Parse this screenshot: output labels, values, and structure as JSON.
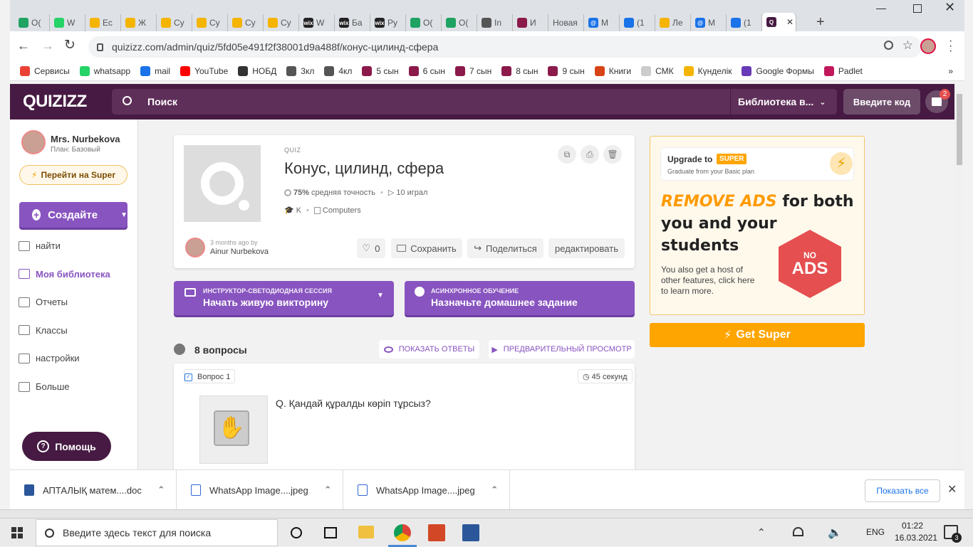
{
  "browser": {
    "tabs": [
      {
        "label": "О(",
        "color": "#1ea362",
        "glyph": ""
      },
      {
        "label": "W",
        "color": "#25d366",
        "glyph": ""
      },
      {
        "label": "Ес",
        "color": "#f4b400",
        "glyph": ""
      },
      {
        "label": "Ж",
        "color": "#f4b400",
        "glyph": ""
      },
      {
        "label": "Су",
        "color": "#f4b400",
        "glyph": ""
      },
      {
        "label": "Су",
        "color": "#f4b400",
        "glyph": ""
      },
      {
        "label": "Су",
        "color": "#f4b400",
        "glyph": ""
      },
      {
        "label": "Су",
        "color": "#f4b400",
        "glyph": ""
      },
      {
        "label": "W",
        "color": "#222222",
        "glyph": "wix"
      },
      {
        "label": "Ба",
        "color": "#222222",
        "glyph": "wix"
      },
      {
        "label": "Ру",
        "color": "#222222",
        "glyph": "wix"
      },
      {
        "label": "О(",
        "color": "#1ea362",
        "glyph": ""
      },
      {
        "label": "О(",
        "color": "#1ea362",
        "glyph": ""
      },
      {
        "label": "In",
        "color": "#555555",
        "glyph": ""
      },
      {
        "label": "И",
        "color": "#8b1a4b",
        "glyph": ""
      },
      {
        "label": "Новая",
        "color": "",
        "glyph": ""
      },
      {
        "label": "М",
        "color": "#1a73e8",
        "glyph": "@"
      },
      {
        "label": "(1",
        "color": "#1a73e8",
        "glyph": ""
      },
      {
        "label": "Ле",
        "color": "#f4b400",
        "glyph": ""
      },
      {
        "label": "М",
        "color": "#1a73e8",
        "glyph": "@"
      },
      {
        "label": "(1",
        "color": "#1a73e8",
        "glyph": ""
      },
      {
        "label": "",
        "color": "#461a42",
        "glyph": "Q",
        "active": true
      }
    ],
    "url": "quizizz.com/admin/quiz/5fd05e491f2f38001d9a488f/конус-цилинд-сфера",
    "bookmarks": [
      {
        "label": "Сервисы",
        "color": "#e94235"
      },
      {
        "label": "whatsapp",
        "color": "#25d366"
      },
      {
        "label": "mail",
        "color": "#1a73e8"
      },
      {
        "label": "YouTube",
        "color": "#ff0000"
      },
      {
        "label": "НОБД",
        "color": "#333333"
      },
      {
        "label": "3кл",
        "color": "#555555"
      },
      {
        "label": "4кл",
        "color": "#555555"
      },
      {
        "label": "5 сын",
        "color": "#8b1a4b"
      },
      {
        "label": "6 сын",
        "color": "#8b1a4b"
      },
      {
        "label": "7 сын",
        "color": "#8b1a4b"
      },
      {
        "label": "8 сын",
        "color": "#8b1a4b"
      },
      {
        "label": "9 сын",
        "color": "#8b1a4b"
      },
      {
        "label": "Книги",
        "color": "#d84315"
      },
      {
        "label": "СМК",
        "color": "#cccccc"
      },
      {
        "label": "Күнделік",
        "color": "#f4b400"
      },
      {
        "label": "Google Формы",
        "color": "#673ab7"
      },
      {
        "label": "Padlet",
        "color": "#c2185b"
      }
    ],
    "bookmarks_more": "»"
  },
  "app": {
    "logo": "QUIZIZZ",
    "search_placeholder": "Поиск",
    "library_dropdown": "Библиотека в...",
    "enter_code": "Введите код",
    "gift_badge": "2",
    "colors": {
      "header": "#461a42",
      "primary": "#8854c0",
      "gold": "#ffa502",
      "red": "#e54f4f"
    }
  },
  "sidebar": {
    "user_name": "Mrs. Nurbekova",
    "plan": "План: Базовый",
    "super_button": "Перейти на Super",
    "create_button": "Создайте",
    "nav": [
      {
        "label": "найти",
        "active": false
      },
      {
        "label": "Моя библиотека",
        "active": true
      },
      {
        "label": "Отчеты",
        "active": false
      },
      {
        "label": "Классы",
        "active": false
      },
      {
        "label": "настройки",
        "active": false
      },
      {
        "label": "Больше",
        "active": false
      }
    ],
    "help_button": "Помощь"
  },
  "quiz": {
    "type_label": "QUIZ",
    "title": "Конус, цилинд, сфера",
    "accuracy_value": "75%",
    "accuracy_label": "средняя точность",
    "plays": "10 играл",
    "grade": "K",
    "subject": "Computers",
    "author_time": "3 months ago by",
    "author_name": "Ainur Nurbekova",
    "likes": "0",
    "save": "Сохранить",
    "share": "Поделиться",
    "edit": "редактировать"
  },
  "session": {
    "live_kicker": "ИНСТРУКТОР-СВЕТОДИОДНАЯ СЕССИЯ",
    "live_title": "Начать живую викторину",
    "async_kicker": "АСИНХРОННОЕ ОБУЧЕНИЕ",
    "async_title": "Назначьте домашнее задание"
  },
  "questions": {
    "count_label": "8 вопросы",
    "show_answers": "ПОКАЗАТЬ ОТВЕТЫ",
    "preview": "ПРЕДВАРИТЕЛЬНЫЙ ПРОСМОТР",
    "items": [
      {
        "label": "Вопрос 1",
        "time": "45 секунд",
        "text": "Q. Қандай құралды көріп тұрсыз?"
      }
    ]
  },
  "promo": {
    "upgrade_to": "Upgrade to",
    "super_badge": "SUPER",
    "graduate": "Graduate from your Basic plan",
    "remove_ads": "REMOVE ADS",
    "for_both": "for both",
    "line2": "you and your",
    "line3": "students",
    "no_ads_1": "NO",
    "no_ads_2": "ADS",
    "desc": "You also get a host of other features, click here to learn more.",
    "get_super": "Get Super"
  },
  "downloads": {
    "items": [
      {
        "name": "АПТАЛЫҚ матем....doc"
      },
      {
        "name": "WhatsApp Image....jpeg"
      },
      {
        "name": "WhatsApp Image....jpeg"
      }
    ],
    "show_all": "Показать все"
  },
  "taskbar": {
    "search_placeholder": "Введите здесь текст для поиска",
    "language": "ENG",
    "time": "01:22",
    "date": "16.03.2021",
    "notifications": "3"
  }
}
